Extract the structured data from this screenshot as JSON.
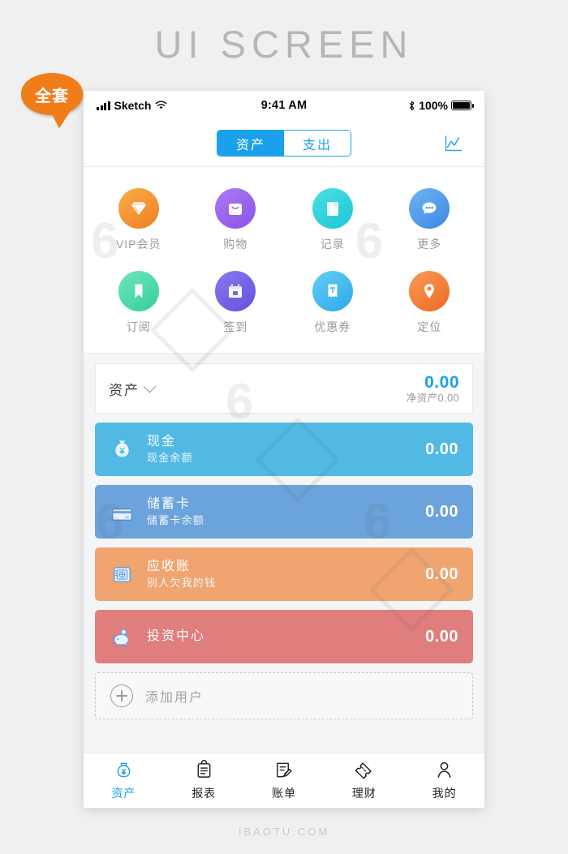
{
  "poster": {
    "title": "UI SCREEN",
    "footer": "IBAOTU.COM",
    "badge": "全套"
  },
  "statusbar": {
    "carrier": "Sketch",
    "time": "9:41 AM",
    "battery_percent": "100%",
    "signal_icon": "signal-bars-icon",
    "wifi_icon": "wifi-icon",
    "bluetooth_icon": "bluetooth-icon",
    "battery_icon": "battery-full-icon"
  },
  "navbar": {
    "segments": [
      {
        "label": "资产",
        "active": true
      },
      {
        "label": "支出",
        "active": false
      }
    ],
    "chart_icon": "line-chart-icon",
    "accent": "#1ba1ec"
  },
  "grid": {
    "items": [
      {
        "label": "VIP会员",
        "icon": "diamond-icon",
        "color": "#f7a23b",
        "color2": "#f5872d"
      },
      {
        "label": "购物",
        "icon": "shopping-bag-icon",
        "color": "#a06ff0",
        "color2": "#8e5ae8"
      },
      {
        "label": "记录",
        "icon": "notebook-icon",
        "color": "#3fd6dd",
        "color2": "#22c7d6"
      },
      {
        "label": "更多",
        "icon": "chat-dots-icon",
        "color": "#5ea8ef",
        "color2": "#3f8fe6"
      },
      {
        "label": "订阅",
        "icon": "bookmark-icon",
        "color": "#5fdcb0",
        "color2": "#3fd49f"
      },
      {
        "label": "签到",
        "icon": "calendar-check-icon",
        "color": "#7b6ae8",
        "color2": "#6a55e0"
      },
      {
        "label": "优惠券",
        "icon": "coupon-receipt-icon",
        "color": "#55c3f0",
        "color2": "#36aeea"
      },
      {
        "label": "定位",
        "icon": "location-pin-icon",
        "color": "#f58a48",
        "color2": "#ef6f28"
      }
    ]
  },
  "summary": {
    "label": "资产",
    "dropdown_icon": "chevron-down-icon",
    "amount": "0.00",
    "subtext": "净资产0.00",
    "amount_color": "#1ba1ec"
  },
  "accounts": [
    {
      "title": "现金",
      "subtitle": "现金余额",
      "amount": "0.00",
      "color": "#52b9e5",
      "icon": "money-bag-icon"
    },
    {
      "title": "储蓄卡",
      "subtitle": "储蓄卡余额",
      "amount": "0.00",
      "color": "#6ba3dc",
      "icon": "credit-card-icon"
    },
    {
      "title": "应收账",
      "subtitle": "别人欠我的钱",
      "amount": "0.00",
      "color": "#f0a571",
      "icon": "safe-box-icon"
    },
    {
      "title": "投资中心",
      "subtitle": "",
      "amount": "0.00",
      "color": "#e07d7d",
      "icon": "piggy-bank-icon"
    }
  ],
  "add_user": {
    "label": "添加用户",
    "icon": "plus-circle-icon"
  },
  "tabbar": {
    "items": [
      {
        "label": "资产",
        "icon": "money-bag-tab-icon",
        "active": true
      },
      {
        "label": "报表",
        "icon": "clipboard-icon",
        "active": false
      },
      {
        "label": "账单",
        "icon": "bill-edit-icon",
        "active": false
      },
      {
        "label": "理财",
        "icon": "ticket-icon",
        "active": false
      },
      {
        "label": "我的",
        "icon": "person-icon",
        "active": false
      }
    ],
    "active_color": "#1ba1ec",
    "inactive_color": "#222222"
  }
}
